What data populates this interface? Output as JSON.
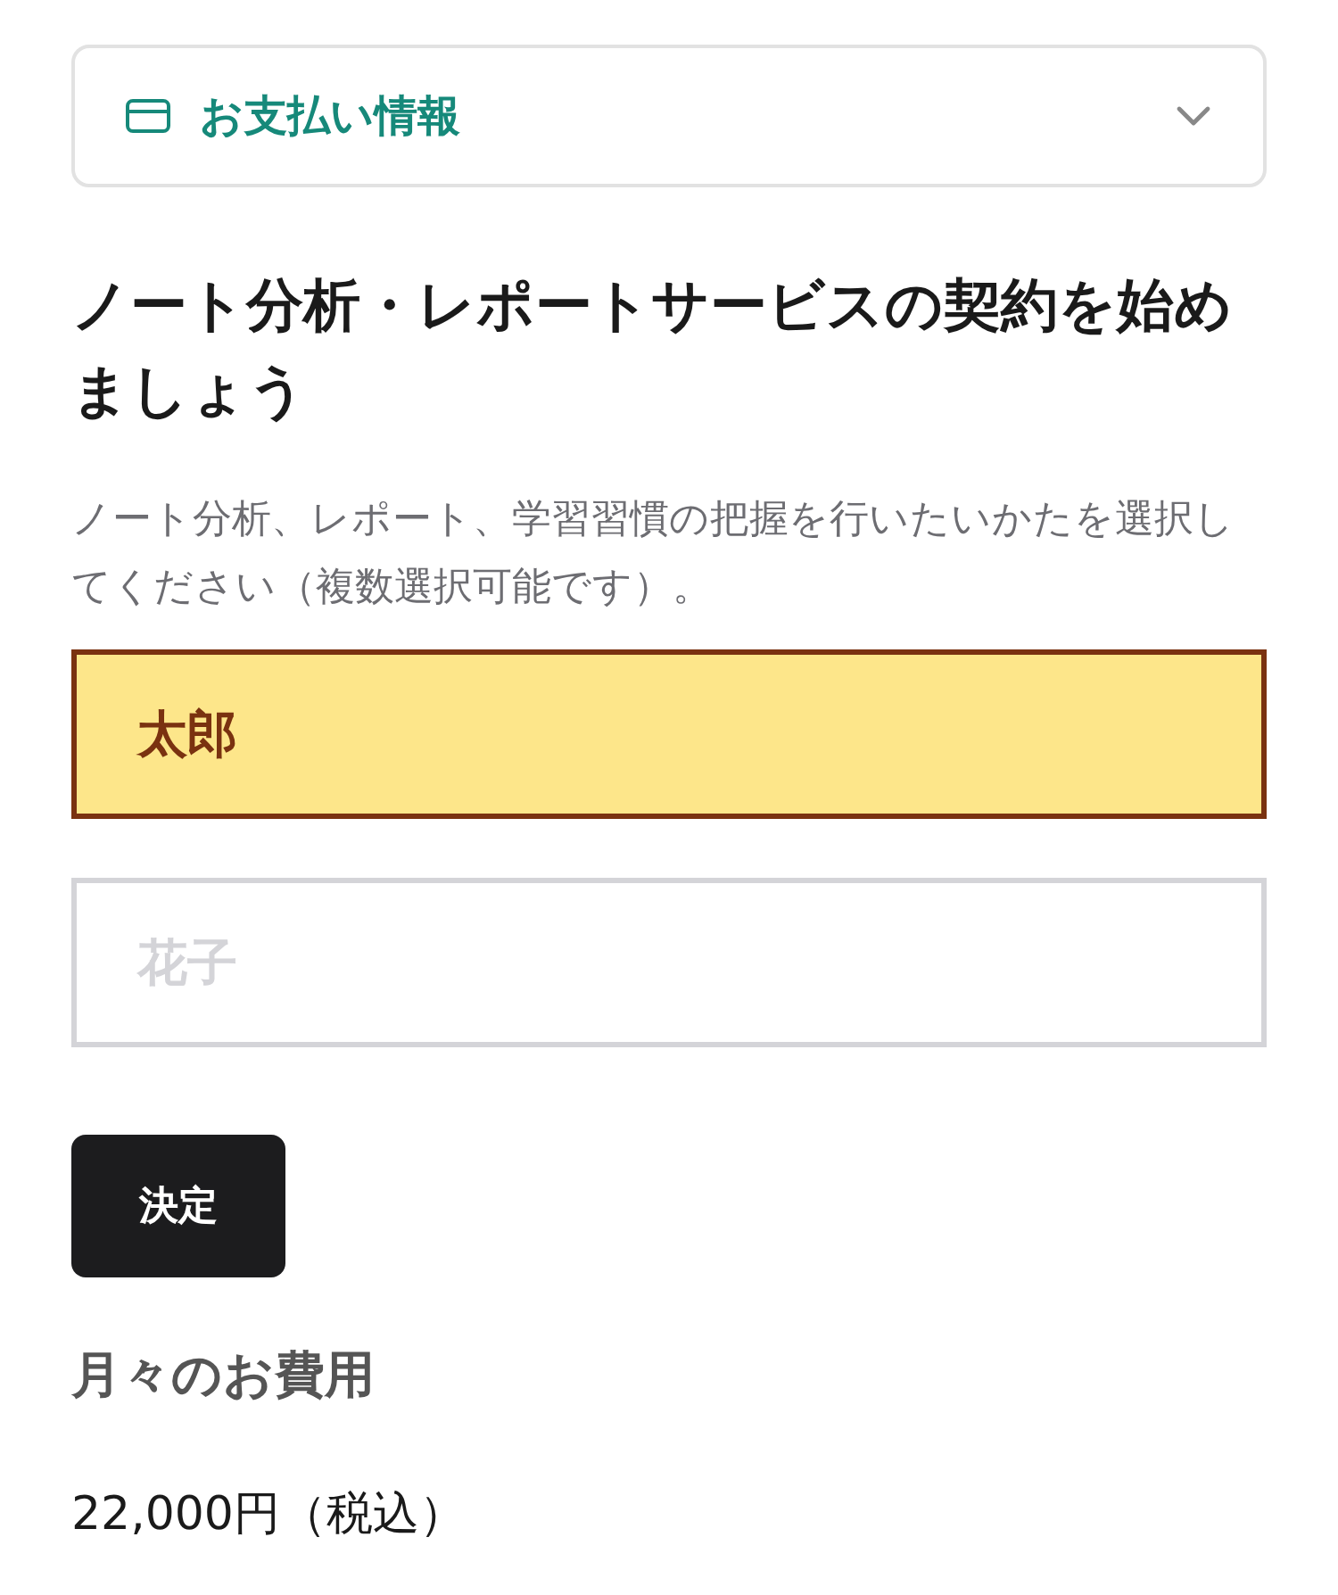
{
  "accordion": {
    "title": "お支払い情報",
    "expanded": false
  },
  "heading": "ノート分析・レポートサービスの契約を始めましょう",
  "description": "ノート分析、レポート、学習習慣の把握を行いたいかたを選択してください（複数選択可能です）。",
  "options": [
    {
      "label": "太郎",
      "selected": true
    },
    {
      "label": "花子",
      "selected": false
    }
  ],
  "submit_button": "決定",
  "fee": {
    "title": "月々のお費用",
    "price": "22,000円（税込）"
  }
}
